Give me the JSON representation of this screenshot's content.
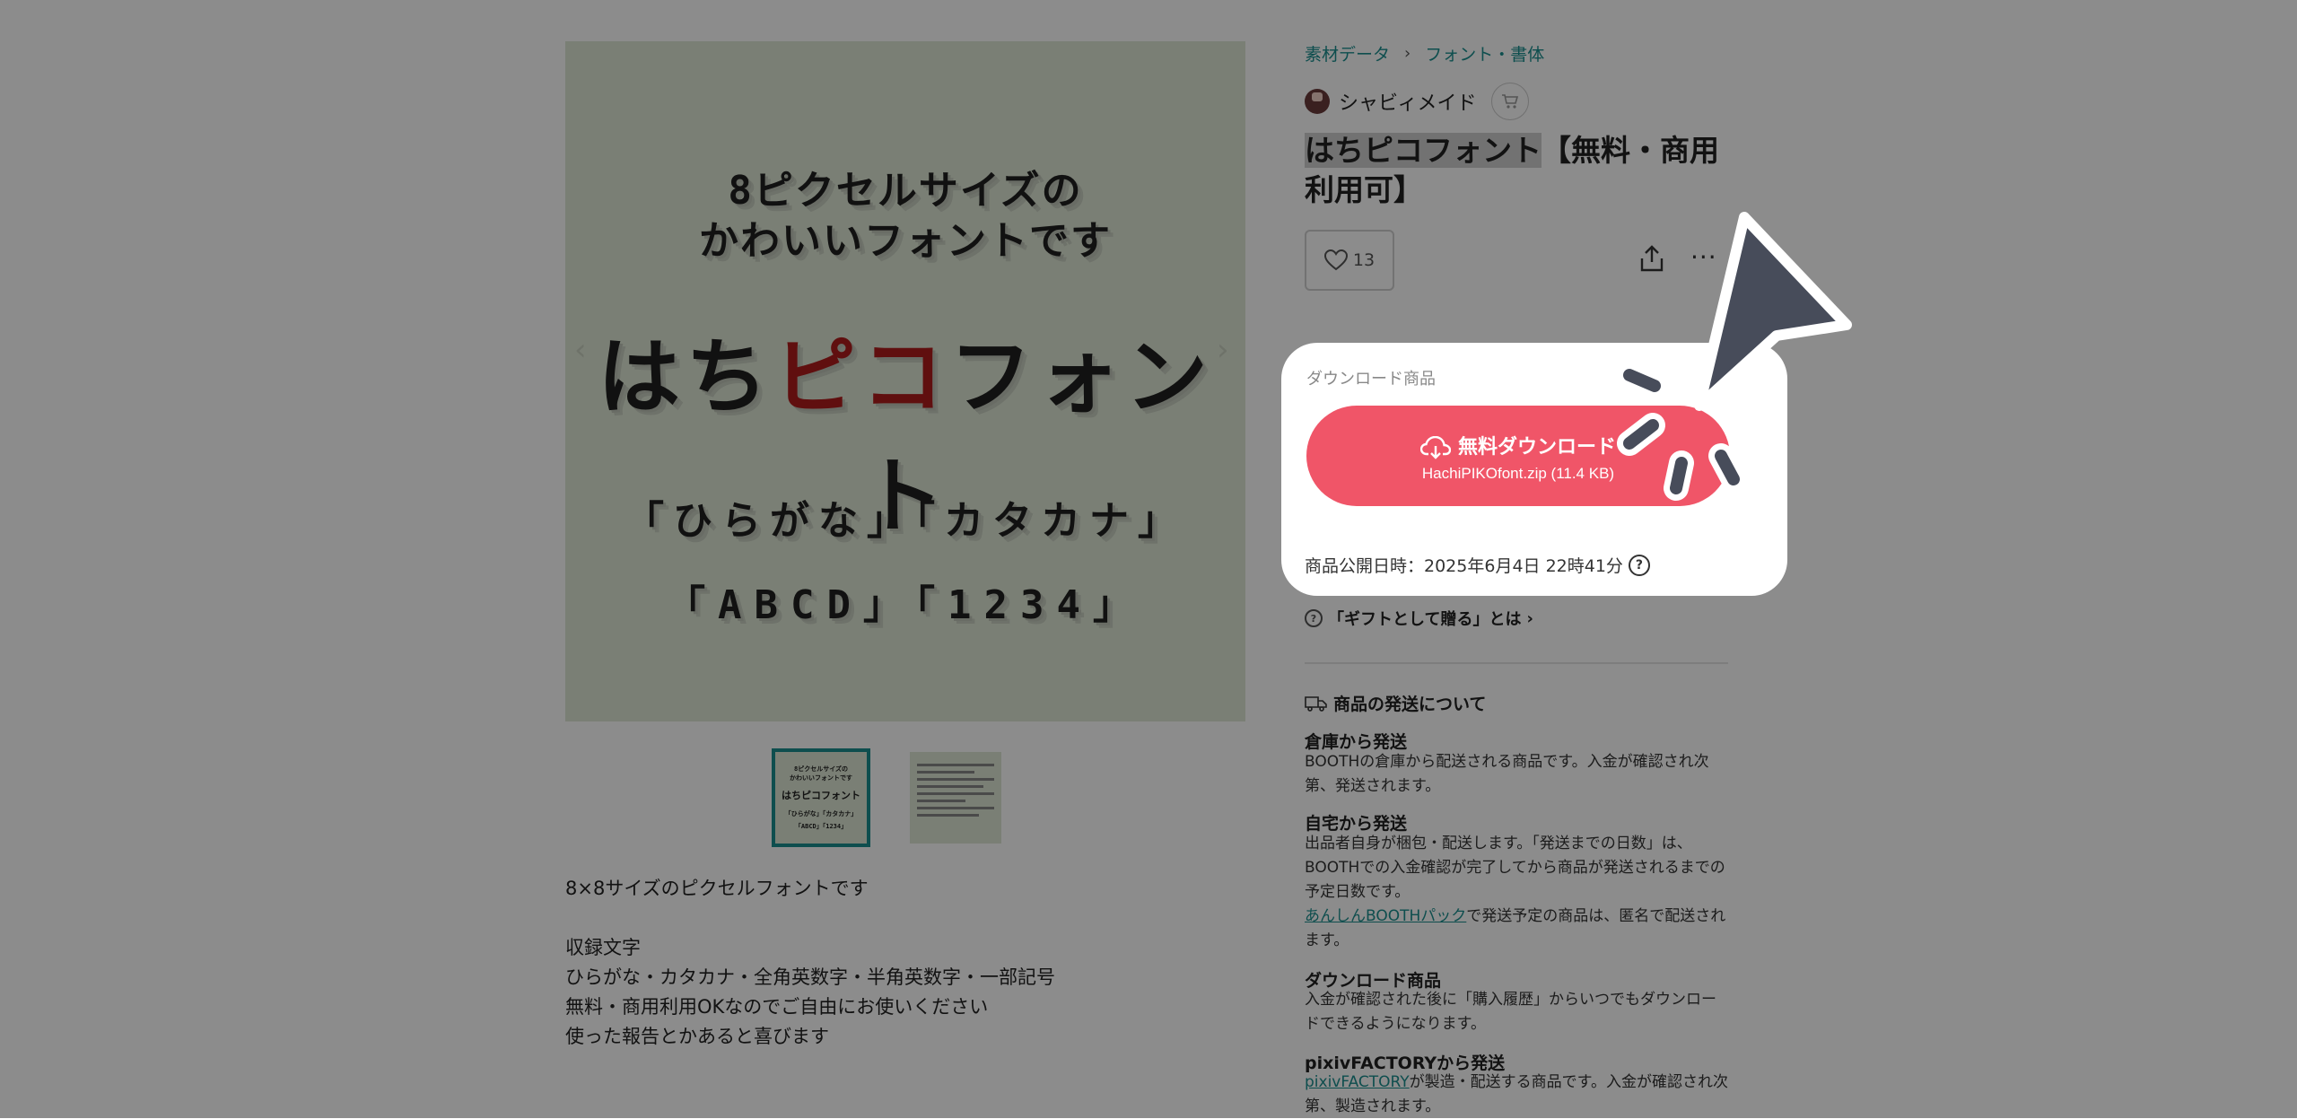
{
  "breadcrumb": {
    "category": "素材データ",
    "separator": "›",
    "subcategory": "フォント・書体"
  },
  "seller": {
    "name": "シャビィメイド"
  },
  "product": {
    "title_highlight": "はちピコフォント",
    "title_rest": "【無料・商用利用可】",
    "like_count": "13"
  },
  "main_image": {
    "line1": "8ピクセルサイズの",
    "line2": "かわいいフォントです",
    "title_a": "はち",
    "title_b": "ピコ",
    "title_c": "フォント",
    "kana": "「ひらがな」「カタカナ」",
    "abcd": "「ABCD」「1234」"
  },
  "thumbnail": {
    "line1": "8ピクセルサイズの",
    "line2": "かわいいフォントです",
    "title": "はちピコフォント",
    "kana": "「ひらがな」「カタカナ」",
    "abcd": "「ABCD」「1234」"
  },
  "description": {
    "p1": "8×8サイズのピクセルフォントです",
    "p2": "収録文字\nひらがな・カタカナ・全角英数字・半角英数字・一部記号",
    "p3": "無料・商用利用OKなのでご自由にお使いください\n使った報告とかあると喜びます"
  },
  "download": {
    "label": "ダウンロード商品",
    "button_label": "無料ダウンロード",
    "file": "HachiPIKOfont.zip (11.4 KB)",
    "publish_date": "商品公開日時：2025年6月4日 22時41分"
  },
  "gift_link": "「ギフトとして贈る」とは",
  "shipping": {
    "heading": "商品の発送について",
    "warehouse_title": "倉庫から発送",
    "warehouse_text": "BOOTHの倉庫から配送される商品です。入金が確認され次第、発送されます。",
    "home_title": "自宅から発送",
    "home_text": "出品者自身が梱包・配送します。「発送までの日数」は、BOOTHでの入金確認が完了してから商品が発送されるまでの予定日数です。",
    "home_link": "あんしんBOOTHパック",
    "home_link_text": "で発送予定の商品は、匿名で配送されます。",
    "download_title": "ダウンロード商品",
    "download_text": "入金が確認された後に「購入履歴」からいつでもダウンロードできるようになります。",
    "factory_title": "pixivFACTORYから発送",
    "factory_link": "pixivFACTORY",
    "factory_text": "が製造・配送する商品です。入金が確認され次第、製造されます。"
  },
  "icons": {
    "cart": "cart-icon",
    "heart": "heart-icon",
    "share": "share-icon",
    "more": "more-icon",
    "cloud": "cloud-download-icon",
    "help": "help-icon",
    "truck": "truck-icon",
    "cursor": "cursor-pointer-icon"
  },
  "colors": {
    "accent": "#1b8e8e",
    "download_button": "#f05568",
    "image_bg": "#dfe8d5",
    "pixel_red": "#b01d1d"
  }
}
